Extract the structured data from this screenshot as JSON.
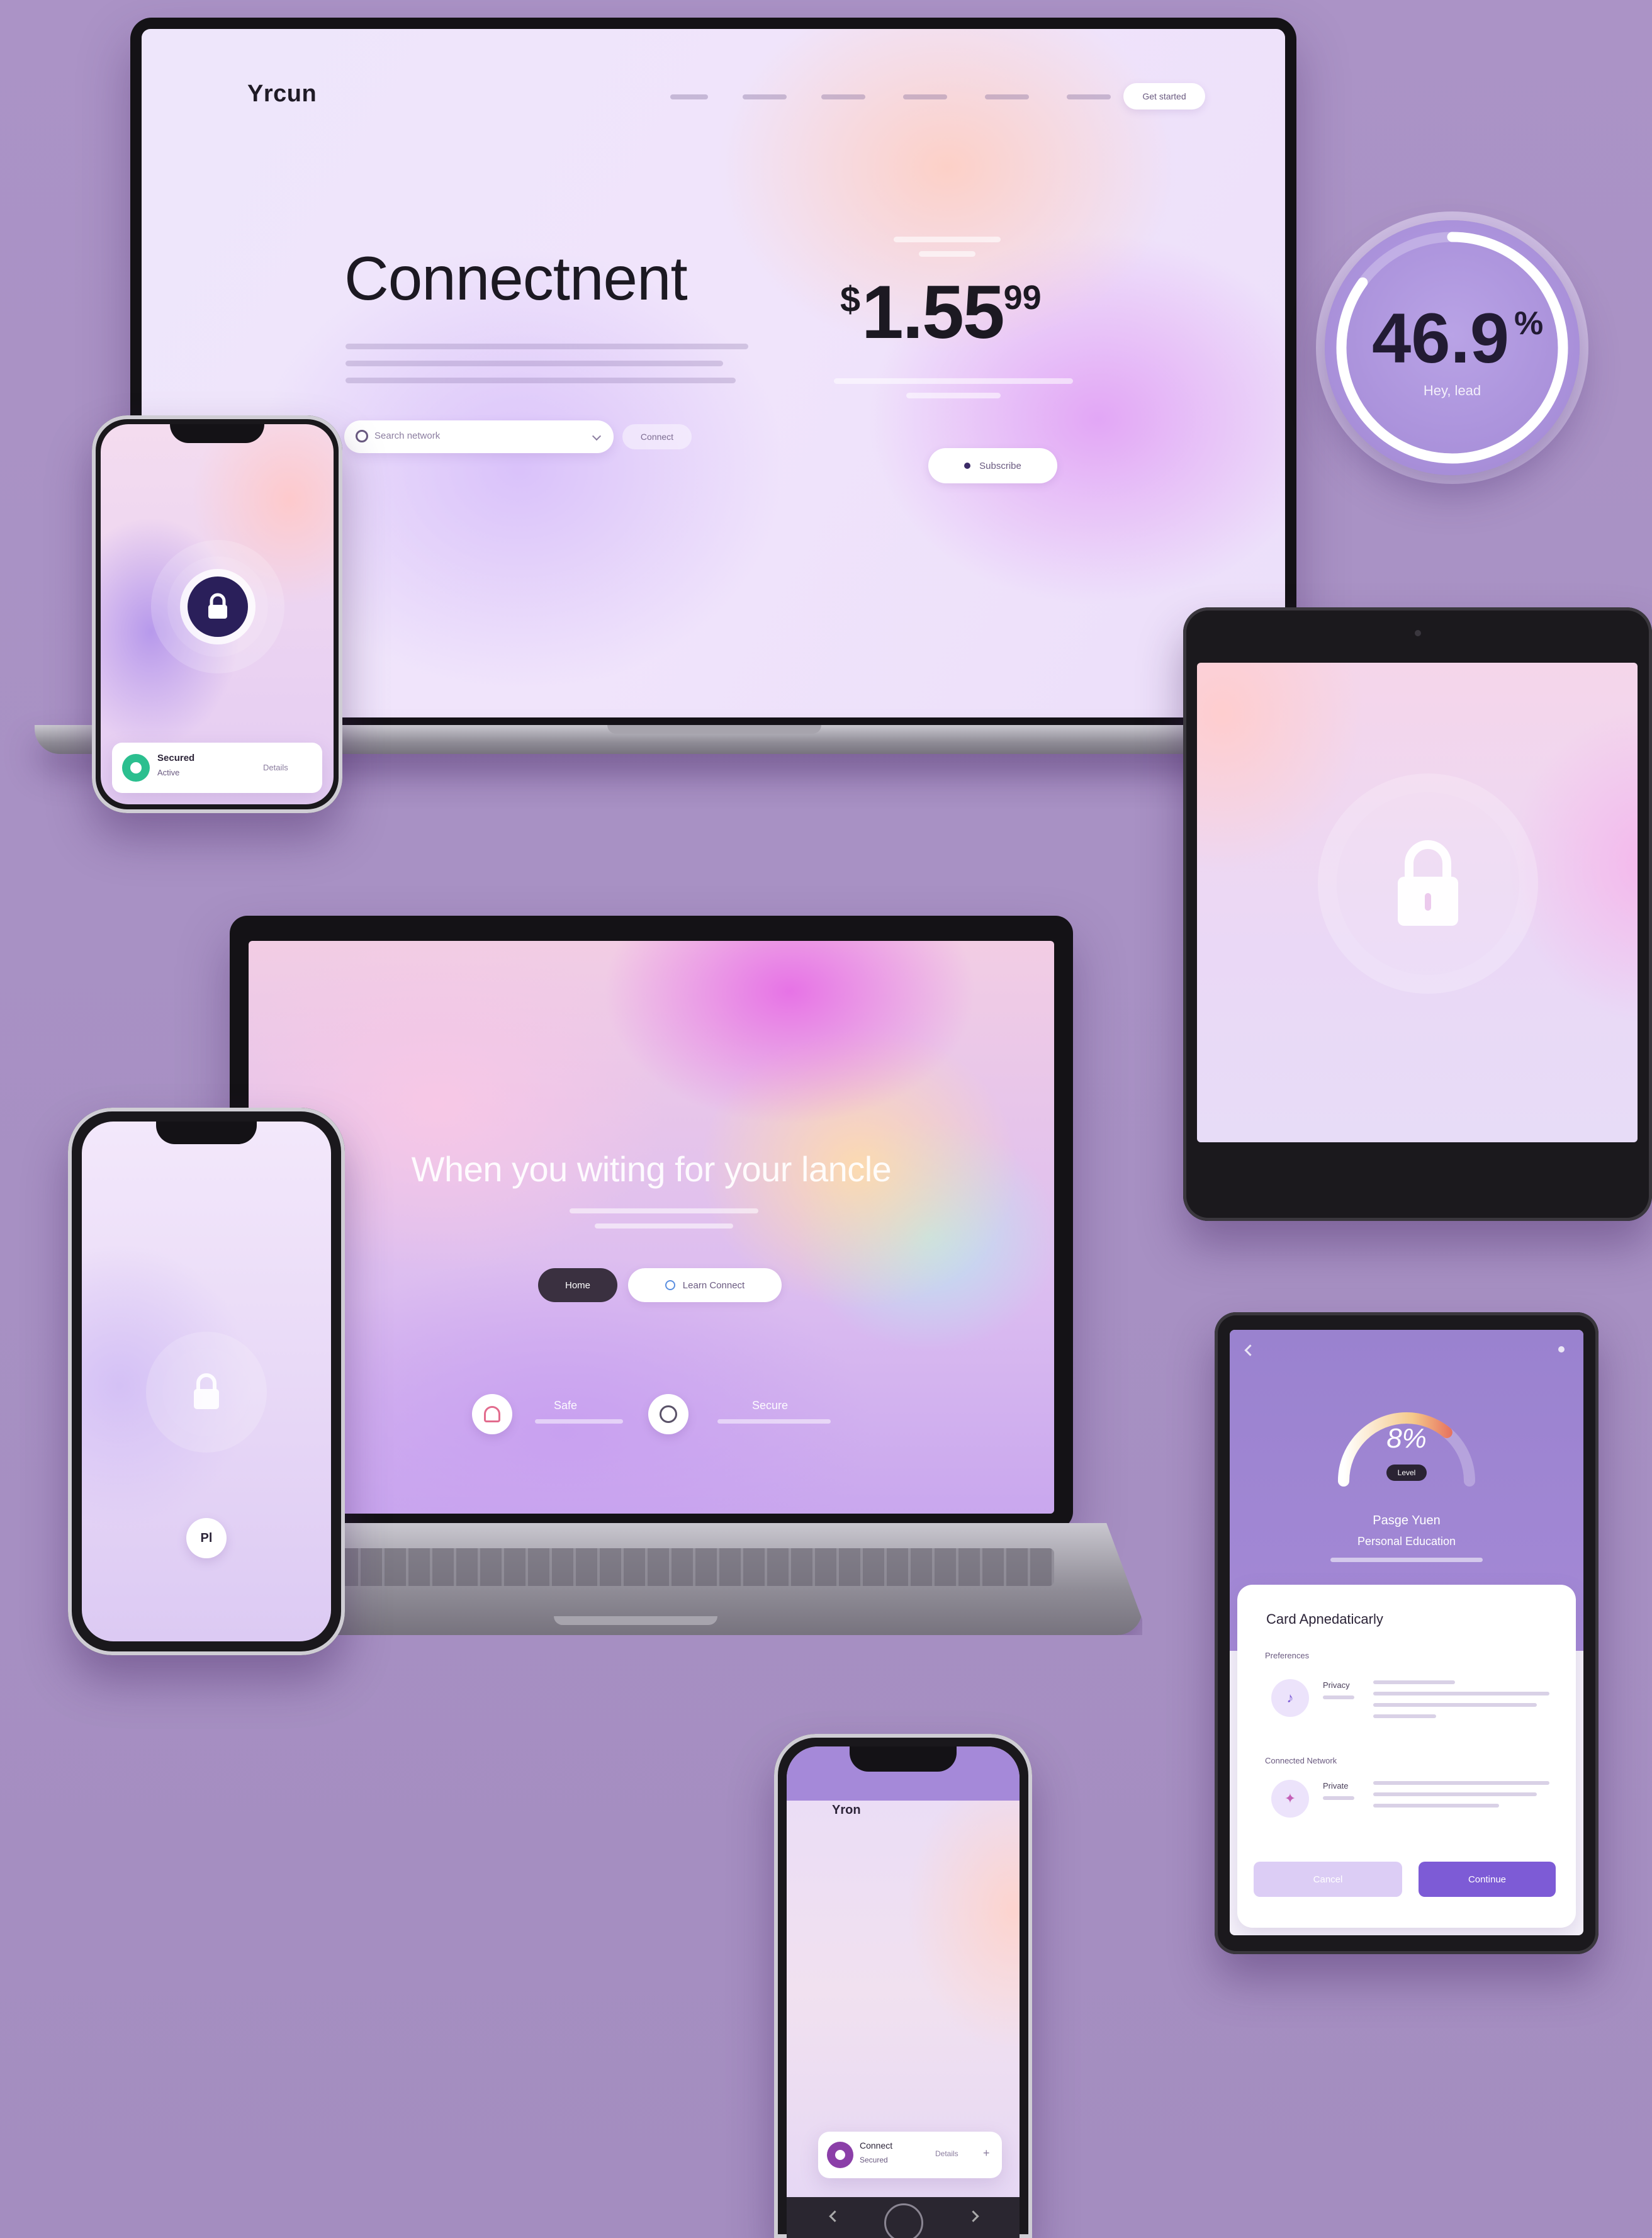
{
  "colors": {
    "background": "#a891c4",
    "accent": "#7d5bd6",
    "dark": "#1c1922",
    "stat_circle": "#a88fd9",
    "gauge": "#e04a4a"
  },
  "laptop_top": {
    "brand": "Yrcun",
    "nav_links": 6,
    "cta_label": "Get started",
    "hero_title": "Connectnent",
    "search_placeholder": "Search network",
    "search_button": "Connect",
    "price_currency": "$",
    "price_main": "1.55",
    "price_cents": "99",
    "plan_button": "Subscribe"
  },
  "stat_badge": {
    "value": "46.9",
    "unit": "%",
    "caption": "Hey, lead",
    "progress_fraction": 0.85
  },
  "phone_top": {
    "lock_icon": "lock-icon",
    "card_title": "Secured",
    "card_sub": "Active",
    "card_action": "Details"
  },
  "laptop_bottom": {
    "hero_title": "When you witing for your lancle",
    "primary_button": "Home",
    "secondary_button": "Learn Connect",
    "features": [
      {
        "icon": "bell-icon",
        "label": "Safe"
      },
      {
        "icon": "chat-icon",
        "label": "Secure"
      }
    ]
  },
  "tablet_top": {
    "lock_icon": "lock-icon"
  },
  "phone_left": {
    "lock_icon": "lock-icon",
    "badge": "Pl"
  },
  "tablet_bottom": {
    "gauge_value": "8%",
    "gauge_pill": "Level",
    "gauge_fraction": 0.72,
    "heading": "Pasge Yuen",
    "subheading": "Personal Education",
    "card_title": "Card Apnedaticarly",
    "section_one": "Preferences",
    "section_two": "Connected Network",
    "row_one_label": "Privacy",
    "row_two_label": "Private",
    "button_secondary": "Cancel",
    "button_primary": "Continue"
  },
  "phone_bottom": {
    "brand": "Yron",
    "card_title": "Connect",
    "card_sub": "Secured",
    "card_action": "Details"
  }
}
